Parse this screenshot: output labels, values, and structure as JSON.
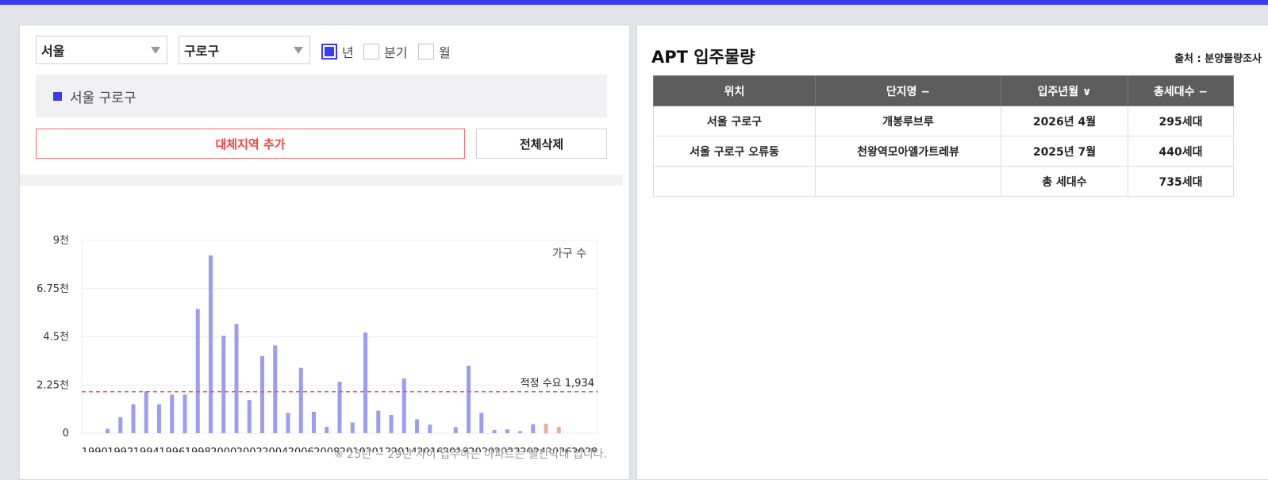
{
  "filters": {
    "city": "서울",
    "district": "구로구",
    "period_options": [
      {
        "label": "년",
        "checked": true
      },
      {
        "label": "분기",
        "checked": false
      },
      {
        "label": "월",
        "checked": false
      }
    ]
  },
  "region_list": {
    "item": "서울 구로구"
  },
  "buttons": {
    "add_region": "대체지역 추가",
    "delete_all": "전체삭제"
  },
  "chart_data": {
    "type": "bar",
    "legend_label": "가구 수",
    "x_ticks": [
      "1990",
      "1992",
      "1994",
      "1996",
      "1998",
      "2000",
      "2002",
      "2004",
      "2006",
      "2008",
      "2010",
      "2012",
      "2014",
      "2016",
      "2018",
      "2020",
      "2022",
      "2024",
      "2026",
      "2028"
    ],
    "y_ticks": [
      "0",
      "2.25천",
      "4.5천",
      "6.75천",
      "9천"
    ],
    "ylim": [
      0,
      9000
    ],
    "x_range": [
      1989,
      2029
    ],
    "threshold": {
      "label": "적정 수요 1,934",
      "value": 1934
    },
    "series": [
      {
        "year": 1991,
        "value": 200
      },
      {
        "year": 1992,
        "value": 750
      },
      {
        "year": 1993,
        "value": 1350
      },
      {
        "year": 1994,
        "value": 1950
      },
      {
        "year": 1995,
        "value": 1350
      },
      {
        "year": 1996,
        "value": 1800
      },
      {
        "year": 1997,
        "value": 1800
      },
      {
        "year": 1998,
        "value": 5800
      },
      {
        "year": 1999,
        "value": 8300
      },
      {
        "year": 2000,
        "value": 4550
      },
      {
        "year": 2001,
        "value": 5100
      },
      {
        "year": 2002,
        "value": 1550
      },
      {
        "year": 2003,
        "value": 3600
      },
      {
        "year": 2004,
        "value": 4100
      },
      {
        "year": 2005,
        "value": 950
      },
      {
        "year": 2006,
        "value": 3050
      },
      {
        "year": 2007,
        "value": 1000
      },
      {
        "year": 2008,
        "value": 300
      },
      {
        "year": 2009,
        "value": 2400
      },
      {
        "year": 2010,
        "value": 500
      },
      {
        "year": 2011,
        "value": 4700
      },
      {
        "year": 2012,
        "value": 1050
      },
      {
        "year": 2013,
        "value": 850
      },
      {
        "year": 2014,
        "value": 2550
      },
      {
        "year": 2015,
        "value": 650
      },
      {
        "year": 2016,
        "value": 400
      },
      {
        "year": 2018,
        "value": 280
      },
      {
        "year": 2019,
        "value": 3150
      },
      {
        "year": 2020,
        "value": 950
      },
      {
        "year": 2021,
        "value": 150
      },
      {
        "year": 2022,
        "value": 180
      },
      {
        "year": 2023,
        "value": 100
      },
      {
        "year": 2024,
        "value": 420
      },
      {
        "year": 2025,
        "value": 440
      },
      {
        "year": 2026,
        "value": 295
      }
    ],
    "highlight_from_year": 2025,
    "colors": {
      "bar": "#9d9cf3",
      "highlight": "#f2a7a3",
      "threshold": "#ee5656",
      "grid": "#ececef"
    }
  },
  "footnote": "※ 25년 ~ 29년 사이 입주하는 아파트는 빨간막대 입니다.",
  "apt_panel": {
    "title": "APT 입주물량",
    "source": "출처 : 분양물량조사",
    "headers": [
      "위치",
      "단지명 −",
      "입주년월 ∨",
      "총세대수 −"
    ],
    "rows": [
      [
        "서울 구로구",
        "개봉루브루",
        "2026년 4월",
        "295세대"
      ],
      [
        "서울 구로구 오류동",
        "천왕역모아엘가트레뷰",
        "2025년 7월",
        "440세대"
      ],
      [
        "",
        "",
        "총 세대수",
        "735세대"
      ]
    ]
  }
}
